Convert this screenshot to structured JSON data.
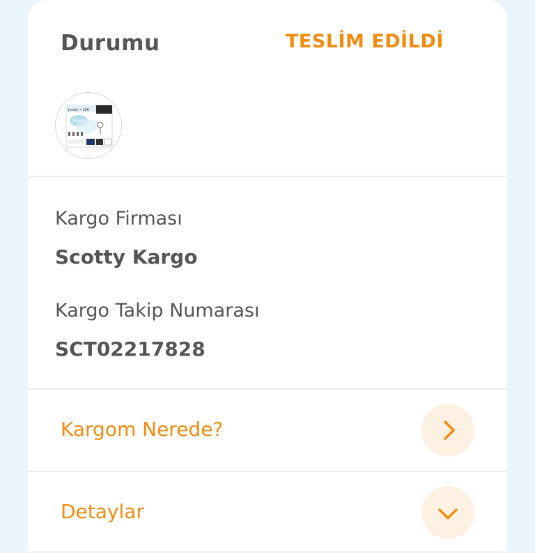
{
  "status": {
    "label": "Durumu",
    "value": "TESLİM EDİLDİ"
  },
  "product": {
    "thumbnail_text": "Junior • 100",
    "brand": "Sleepy",
    "icon": "product-image-icon"
  },
  "shipping": {
    "company_label": "Kargo Firması",
    "company_value": "Scotty Kargo",
    "tracking_label": "Kargo Takip Numarası",
    "tracking_value": "SCT02217828"
  },
  "actions": {
    "track_label": "Kargom Nerede?",
    "track_icon": "chevron-right-icon",
    "details_label": "Detaylar",
    "details_icon": "chevron-down-icon"
  },
  "colors": {
    "accent": "#f28c0f",
    "accent_soft": "#fdf1e3",
    "text": "#555555",
    "background": "#e9f4fb"
  }
}
